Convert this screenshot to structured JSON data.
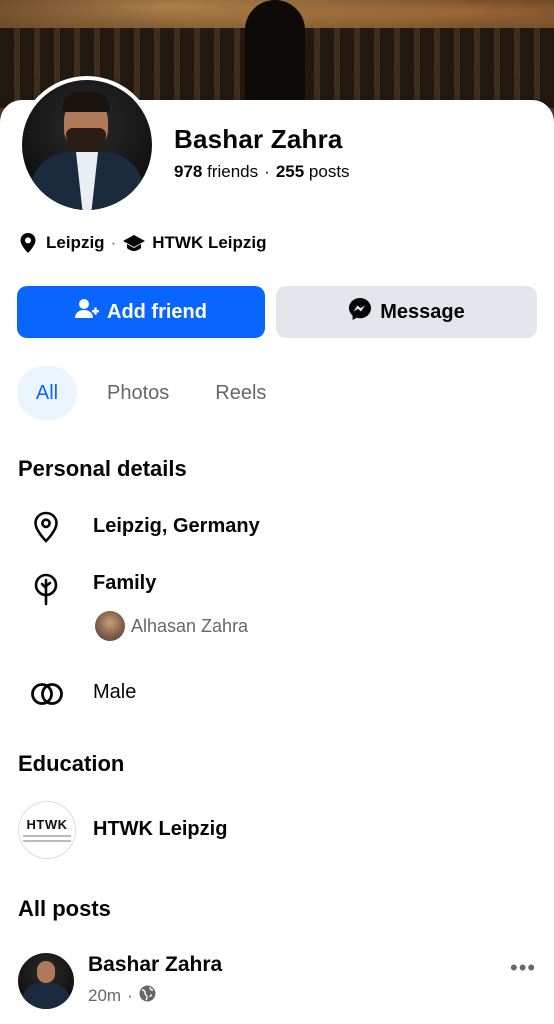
{
  "profile": {
    "name": "Bashar Zahra",
    "friends_count": "978",
    "friends_label": "friends",
    "posts_count": "255",
    "posts_label": "posts",
    "location_short": "Leipzig",
    "school_short": "HTWK Leipzig"
  },
  "actions": {
    "add_friend_label": "Add friend",
    "message_label": "Message"
  },
  "tabs": [
    {
      "label": "All",
      "active": true
    },
    {
      "label": "Photos",
      "active": false
    },
    {
      "label": "Reels",
      "active": false
    }
  ],
  "personal_details": {
    "title": "Personal details",
    "location": "Leipzig, Germany",
    "family_label": "Family",
    "family_member": "Alhasan Zahra",
    "gender": "Male"
  },
  "education": {
    "title": "Education",
    "school": "HTWK Leipzig",
    "logo_text": "HTWK"
  },
  "posts": {
    "title": "All posts",
    "first_post": {
      "author": "Bashar Zahra",
      "time": "20m",
      "more": "•••"
    }
  },
  "colors": {
    "primary": "#0866ff",
    "secondary_button": "#e4e6eb",
    "tab_active_bg": "#ebf5ff",
    "muted_text": "#65676b"
  },
  "icons": [
    "location-pin-icon",
    "graduation-cap-icon",
    "add-friend-icon",
    "messenger-icon",
    "family-tree-icon",
    "gender-icon",
    "globe-icon",
    "more-icon"
  ]
}
